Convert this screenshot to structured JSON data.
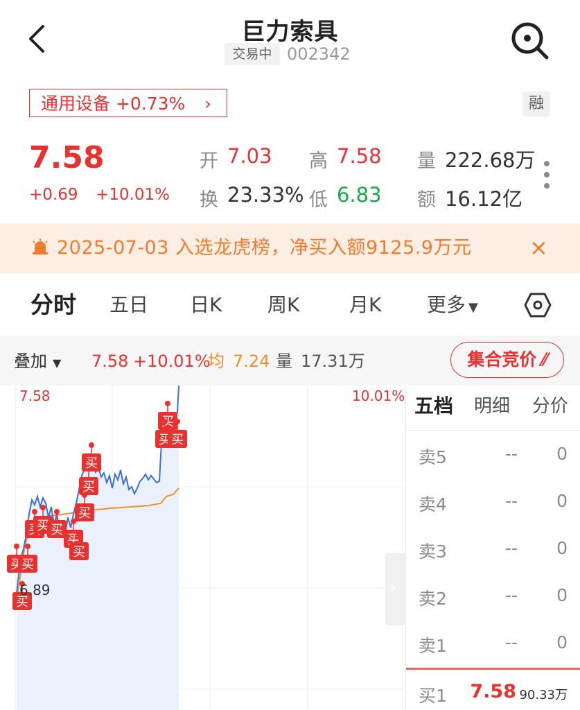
{
  "header": {
    "title": "巨力索具",
    "status": "交易中",
    "code": "002342",
    "sector_label": "通用设备 +0.73%",
    "margin_badge": "融"
  },
  "quote": {
    "price": "7.58",
    "change": "+0.69",
    "change_pct": "+10.01%",
    "open_label": "开",
    "open": "7.03",
    "high_label": "高",
    "high": "7.58",
    "volume_label": "量",
    "volume": "222.68万",
    "turnover_label": "换",
    "turnover": "23.33%",
    "low_label": "低",
    "low": "6.83",
    "amount_label": "额",
    "amount": "16.12亿"
  },
  "banner": {
    "text": "2025-07-03 入选龙虎榜，净买入额9125.9万元",
    "close": "×"
  },
  "tabs": [
    "分时",
    "五日",
    "日K",
    "周K",
    "月K",
    "更多"
  ],
  "overlay": {
    "label": "叠加",
    "price": "7.58",
    "pct": "+10.01%",
    "avg_label": "均",
    "avg": "7.24",
    "vol_label": "量",
    "vol": "17.31万",
    "auction": "集合竞价"
  },
  "chart": {
    "top_price": "7.58",
    "top_pct": "10.01%",
    "low_price": "6.89",
    "marker_label": "买"
  },
  "order_book": {
    "tabs": [
      "五档",
      "明细",
      "分价"
    ],
    "asks": [
      {
        "label": "卖5",
        "price": "--",
        "vol": "0"
      },
      {
        "label": "卖4",
        "price": "--",
        "vol": "0"
      },
      {
        "label": "卖3",
        "price": "--",
        "vol": "0"
      },
      {
        "label": "卖2",
        "price": "--",
        "vol": "0"
      },
      {
        "label": "卖1",
        "price": "--",
        "vol": "0"
      }
    ],
    "bids": [
      {
        "label": "买1",
        "price": "7.58",
        "vol": "90.33万"
      }
    ]
  },
  "colors": {
    "up": "#e8322f",
    "down": "#1aa64a",
    "price_line": "#3b6fe0",
    "avg_line": "#f0902a",
    "banner": "#f07b2e"
  }
}
